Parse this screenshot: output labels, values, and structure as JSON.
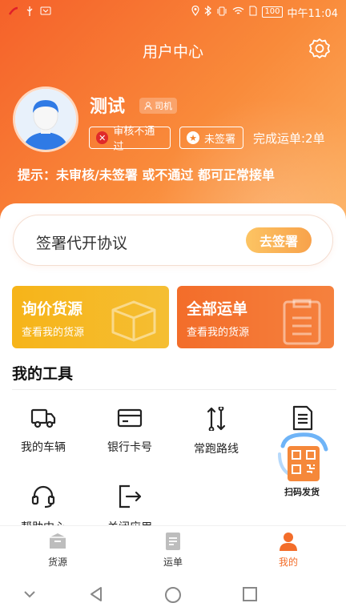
{
  "status_bar": {
    "network": "100",
    "time": "中午11:04"
  },
  "header": {
    "title": "用户中心"
  },
  "profile": {
    "name": "测试",
    "role_badge": "司机",
    "audit_status": "审核不通过",
    "sign_status": "未签署",
    "completed_orders": "完成运单:2单",
    "tip": "提示：未审核/未签署 或不通过 都可正常接单"
  },
  "agreement": {
    "text": "签署代开协议",
    "button": "去签署"
  },
  "cards": [
    {
      "title": "询价货源",
      "subtitle": "查看我的货源"
    },
    {
      "title": "全部运单",
      "subtitle": "查看我的货源"
    }
  ],
  "tools": {
    "title": "我的工具",
    "items": [
      {
        "label": "我的车辆",
        "icon": "truck-icon"
      },
      {
        "label": "银行卡号",
        "icon": "bank-card-icon"
      },
      {
        "label": "常跑路线",
        "icon": "route-icon"
      },
      {
        "label": "",
        "icon": "document-icon"
      },
      {
        "label": "帮助中心",
        "icon": "headset-icon"
      },
      {
        "label": "关闭应用",
        "icon": "exit-icon"
      }
    ]
  },
  "floating": {
    "label": "扫码发货"
  },
  "tabbar": {
    "items": [
      {
        "label": "货源",
        "active": false
      },
      {
        "label": "运单",
        "active": false
      },
      {
        "label": "我的",
        "active": true
      }
    ]
  },
  "colors": {
    "primary_orange": "#f36d2a",
    "accent_yellow": "#f6b419",
    "inactive_gray": "#bdbdbd"
  }
}
